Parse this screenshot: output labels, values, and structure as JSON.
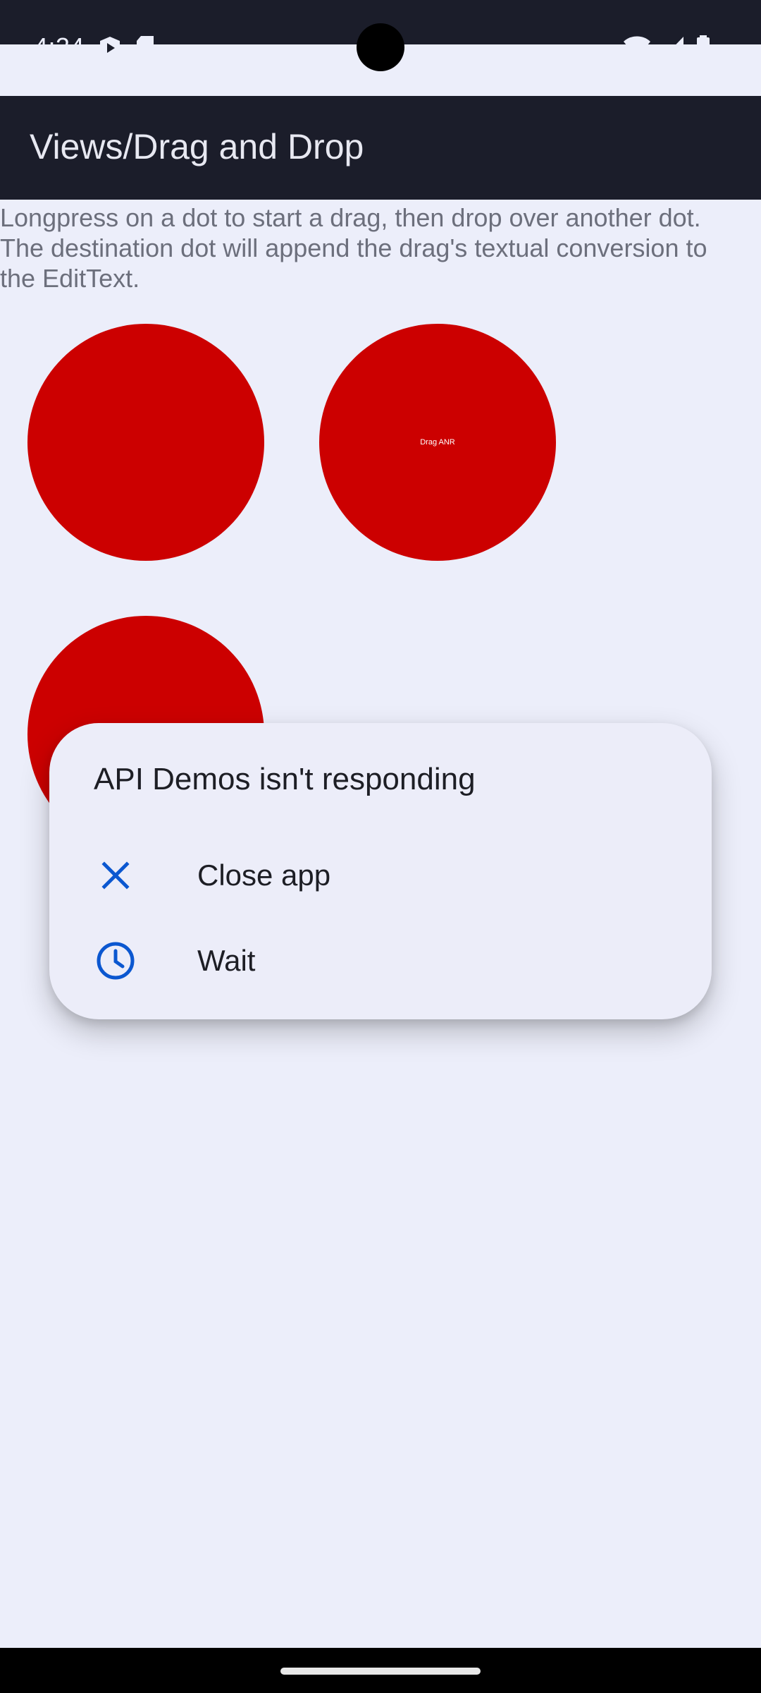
{
  "status_bar": {
    "time": "4:34",
    "left_icons": [
      "play-protect-icon",
      "sd-card-icon"
    ],
    "right_icons": [
      "wifi-icon",
      "signal-icon",
      "battery-icon"
    ]
  },
  "app_bar": {
    "title": "Views/Drag and Drop"
  },
  "main": {
    "instructions": "Longpress on a dot to start a drag, then drop over another dot. The destination dot will append the drag's textual conversion to the EditText.",
    "dots": [
      {
        "label": ""
      },
      {
        "label": "Drag ANR"
      },
      {
        "label": ""
      }
    ],
    "dot_color": "#cc0000"
  },
  "dialog": {
    "title": "API Demos isn't responding",
    "options": [
      {
        "label": "Close app",
        "icon": "close-icon"
      },
      {
        "label": "Wait",
        "icon": "clock-icon"
      }
    ],
    "accent_color": "#0b57d0"
  }
}
